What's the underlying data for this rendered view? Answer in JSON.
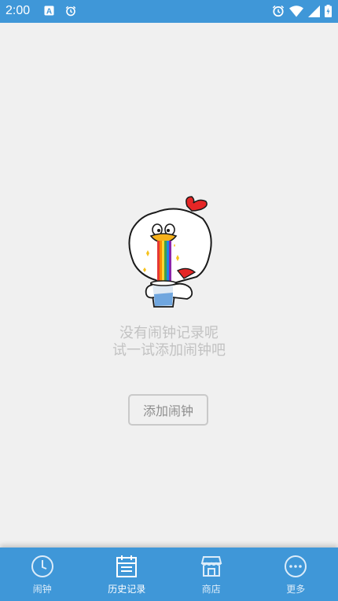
{
  "status_bar": {
    "time": "2:00",
    "left_icons": [
      "text-a-icon",
      "alarm-icon"
    ],
    "right_icons": [
      "alarm-icon",
      "wifi-icon",
      "signal-icon",
      "battery-icon"
    ]
  },
  "empty_state": {
    "illustration": "chicken-rainbow-cup-illustration",
    "line1": "没有闹钟记录呢",
    "line2": "试一试添加闹钟吧",
    "button_label": "添加闹钟"
  },
  "bottom_nav": {
    "active_index": 1,
    "items": [
      {
        "label": "闹钟",
        "icon": "clock-icon"
      },
      {
        "label": "历史记录",
        "icon": "calendar-history-icon"
      },
      {
        "label": "商店",
        "icon": "store-icon"
      },
      {
        "label": "更多",
        "icon": "more-dots-icon"
      }
    ]
  },
  "colors": {
    "primary": "#3f97d8",
    "background": "#f0f0f0",
    "empty_text": "#c2c2c2",
    "button_border": "#c9c9c9"
  }
}
